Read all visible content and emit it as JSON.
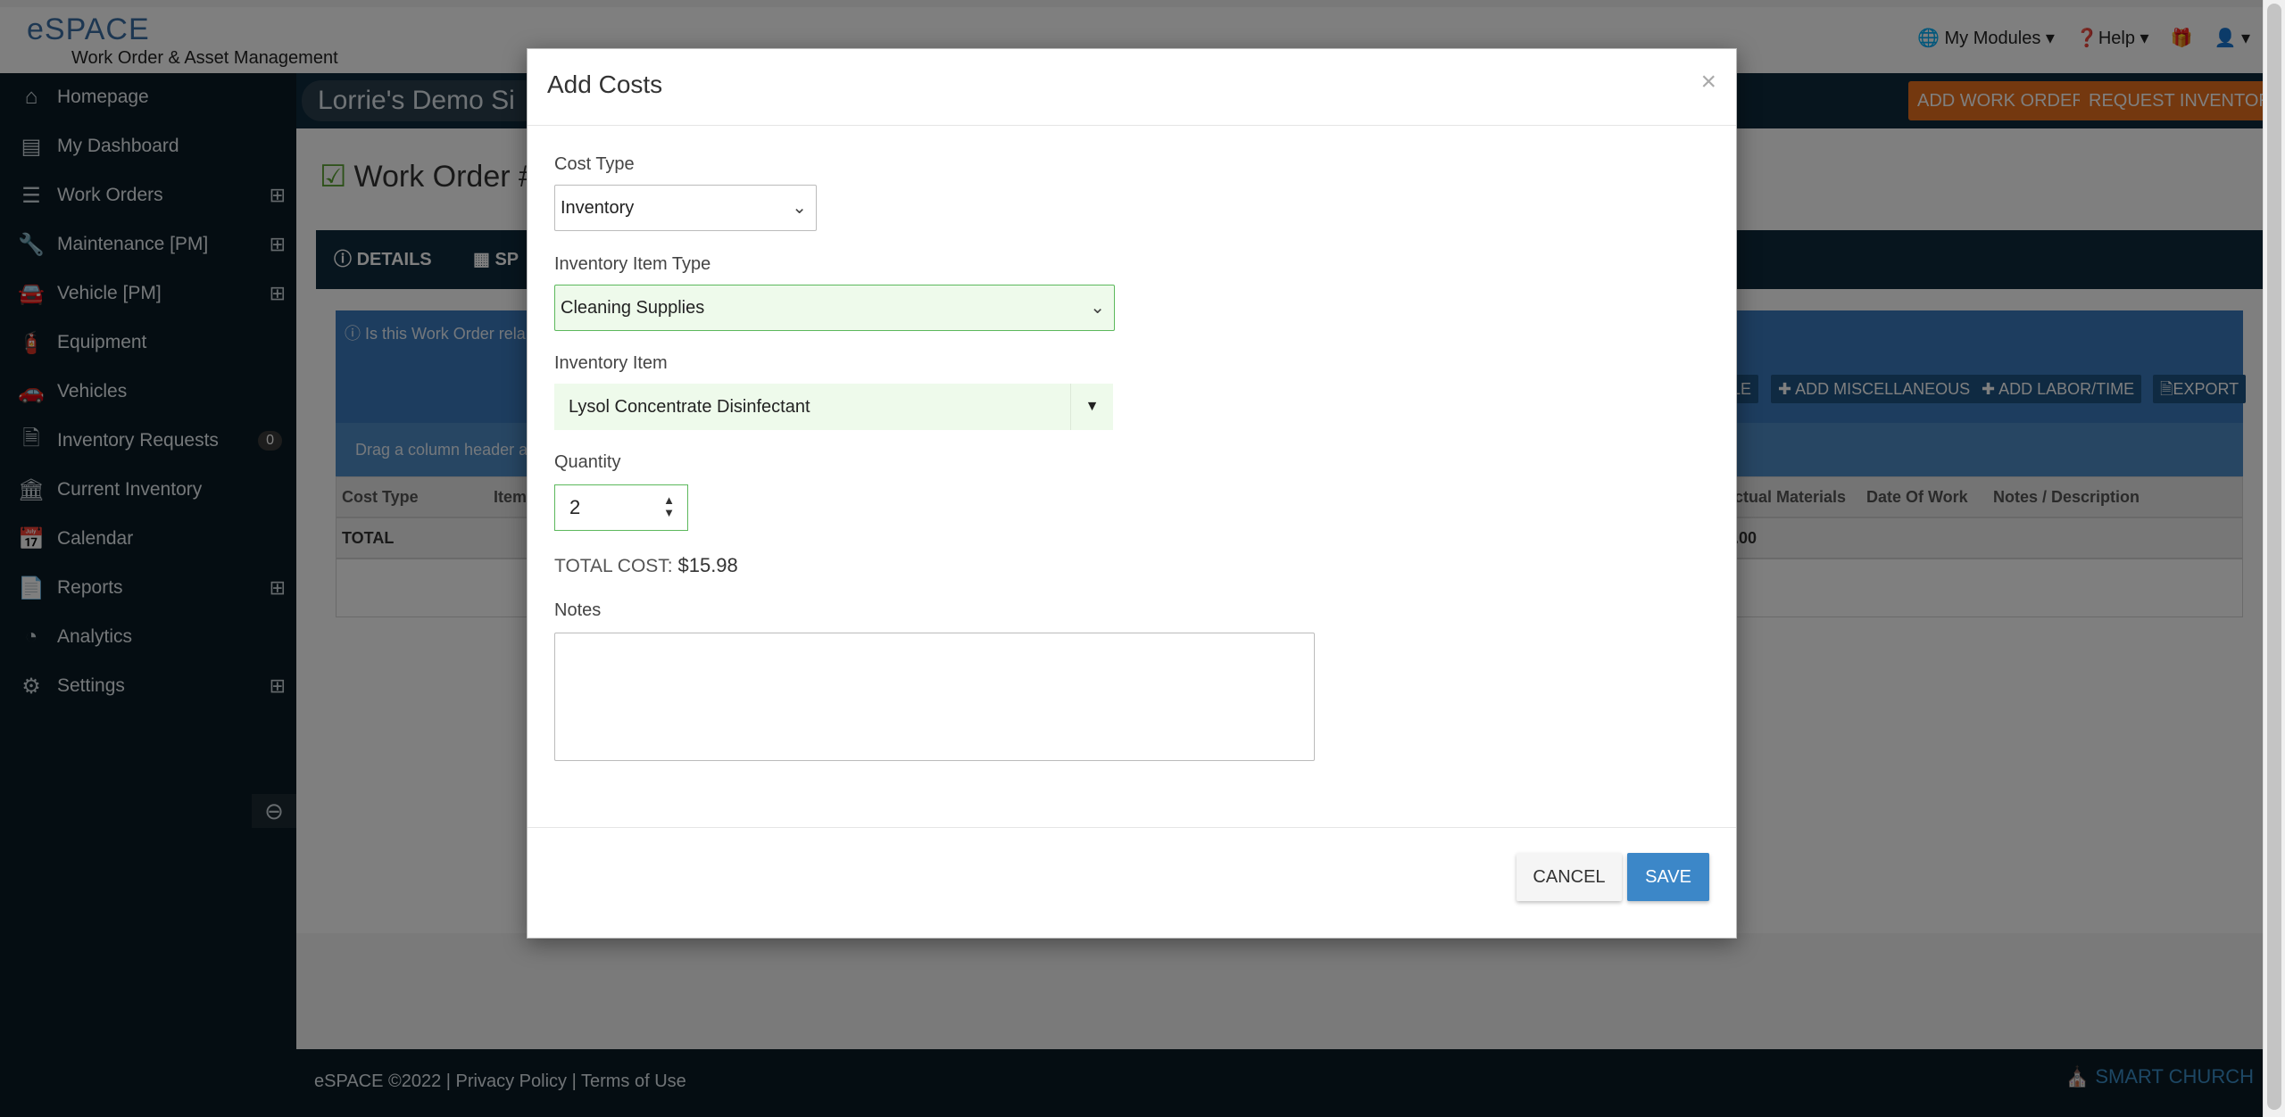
{
  "header": {
    "logo_text": "eSPACE",
    "logo_subtitle": "Work Order & Asset Management",
    "my_modules": "My Modules",
    "help": "Help"
  },
  "sidebar": {
    "items": [
      {
        "label": "Homepage",
        "icon": "home-icon"
      },
      {
        "label": "My Dashboard",
        "icon": "dashboard-icon"
      },
      {
        "label": "Work Orders",
        "icon": "list-icon",
        "expandable": true
      },
      {
        "label": "Maintenance [PM]",
        "icon": "wrench-icon",
        "expandable": true
      },
      {
        "label": "Vehicle [PM]",
        "icon": "car-icon",
        "expandable": true
      },
      {
        "label": "Equipment",
        "icon": "extinguisher-icon"
      },
      {
        "label": "Vehicles",
        "icon": "car-icon"
      },
      {
        "label": "Inventory Requests",
        "icon": "document-icon",
        "badge": "0"
      },
      {
        "label": "Current Inventory",
        "icon": "bank-icon"
      },
      {
        "label": "Calendar",
        "icon": "calendar-icon"
      },
      {
        "label": "Reports",
        "icon": "files-icon",
        "expandable": true
      },
      {
        "label": "Analytics",
        "icon": "pie-chart-icon"
      },
      {
        "label": "Settings",
        "icon": "gear-icon",
        "expandable": true
      }
    ]
  },
  "main": {
    "site_name": "Lorrie's Demo Si",
    "add_work_order": "ADD WORK ORDER",
    "request_inventory": "REQUEST INVENTORY",
    "wo_title": "Work Order #",
    "tabs": [
      "DETAILS",
      "SP"
    ],
    "panel_note": "Is this Work Order rela",
    "panel_buttons": [
      "LE",
      "ADD MISCELLANEOUS",
      "ADD LABOR/TIME",
      "EXPORT"
    ],
    "drag_hint": "Drag a column header a",
    "grid_headers": [
      "Cost Type",
      "Item",
      "ctual Materials",
      "Date Of Work",
      "Notes / Description"
    ],
    "grid_total_label": "TOTAL",
    "grid_total_value": ".00"
  },
  "footer": {
    "copyright": "eSPACE ©2022",
    "privacy": "Privacy Policy",
    "terms": "Terms of Use",
    "logo": "SMART CHURCH"
  },
  "modal": {
    "title": "Add Costs",
    "close": "×",
    "cost_type_label": "Cost Type",
    "cost_type_value": "Inventory",
    "item_type_label": "Inventory Item Type",
    "item_type_value": "Cleaning Supplies",
    "item_label": "Inventory Item",
    "item_value": "Lysol Concentrate Disinfectant",
    "quantity_label": "Quantity",
    "quantity_value": "2",
    "total_cost_label": "TOTAL COST:",
    "total_cost_value": "$15.98",
    "notes_label": "Notes",
    "cancel": "CANCEL",
    "save": "SAVE"
  }
}
